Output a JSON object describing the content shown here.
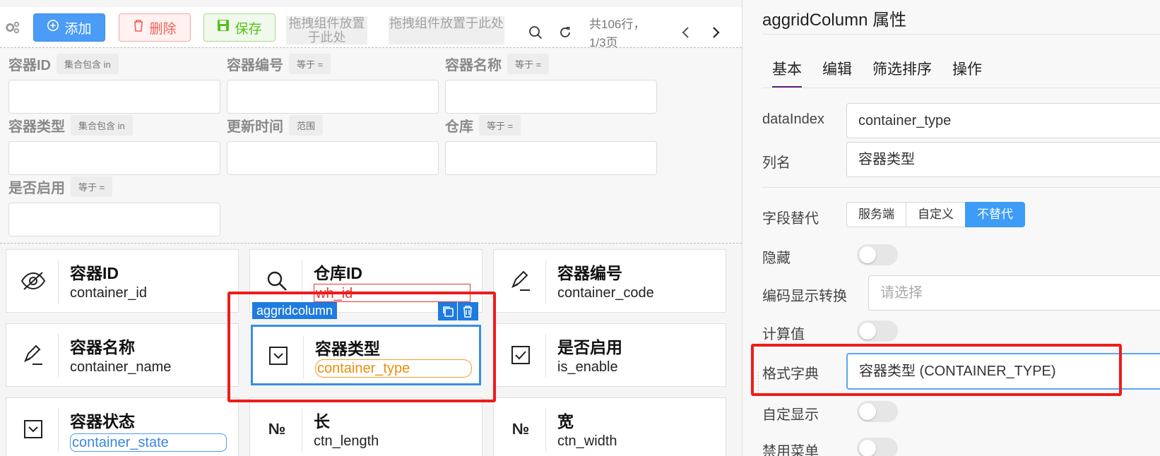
{
  "toolbar": {
    "add_label": "添加",
    "delete_label": "删除",
    "save_label": "保存",
    "slot1_text": "拖拽组件放置于此处",
    "slot2_text": "拖拽组件放置于此处",
    "total_text": "共106行，",
    "page_text": "1/3页"
  },
  "filters": [
    {
      "label": "容器ID",
      "op": "集合包含 in"
    },
    {
      "label": "容器编号",
      "op": "等于 ="
    },
    {
      "label": "容器名称",
      "op": "等于 ="
    },
    {
      "label": "容器类型",
      "op": "集合包含 in"
    },
    {
      "label": "更新时间",
      "op": "范围"
    },
    {
      "label": "仓库",
      "op": "等于 ="
    },
    {
      "label": "是否启用",
      "op": "等于 ="
    }
  ],
  "cards": [
    {
      "title": "容器ID",
      "field": "container_id",
      "icon": "eye-off-icon"
    },
    {
      "title": "仓库ID",
      "field": "wh_id",
      "icon": "search-icon"
    },
    {
      "title": "容器编号",
      "field": "container_code",
      "icon": "pencil-icon"
    },
    {
      "title": "容器名称",
      "field": "container_name",
      "icon": "pencil-icon"
    },
    {
      "title": "容器类型",
      "field": "container_type",
      "icon": "checkbox-icon"
    },
    {
      "title": "是否启用",
      "field": "is_enable",
      "icon": "checkbox-icon"
    },
    {
      "title": "容器状态",
      "field": "container_state",
      "icon": "dropdown-box-icon"
    },
    {
      "title": "长",
      "field": "ctn_length",
      "icon": "number-icon"
    },
    {
      "title": "宽",
      "field": "ctn_width",
      "icon": "number-icon"
    }
  ],
  "selection_tag": "aggridcolumn",
  "number_glyph": "№",
  "panel": {
    "title": "aggridColumn 属性",
    "tabs": [
      "基本",
      "编辑",
      "筛选排序",
      "操作"
    ],
    "dataindex_label": "dataIndex",
    "dataindex_value": "container_type",
    "colname_label": "列名",
    "colname_value": "容器类型",
    "replace_label": "字段替代",
    "replace_options": [
      "服务端",
      "自定义",
      "不替代"
    ],
    "hidden_label": "隐藏",
    "code_convert_label": "编码显示转换",
    "code_convert_placeholder": "请选择",
    "computed_label": "计算值",
    "dict_label": "格式字典",
    "dict_value": "容器类型 (CONTAINER_TYPE)",
    "custom_display_label": "自定显示",
    "disable_menu_label": "禁用菜单"
  },
  "colors": {
    "accent_blue": "#4a9cf6",
    "highlight_red": "#ee1c1c",
    "tab_underline": "#5b2078"
  }
}
